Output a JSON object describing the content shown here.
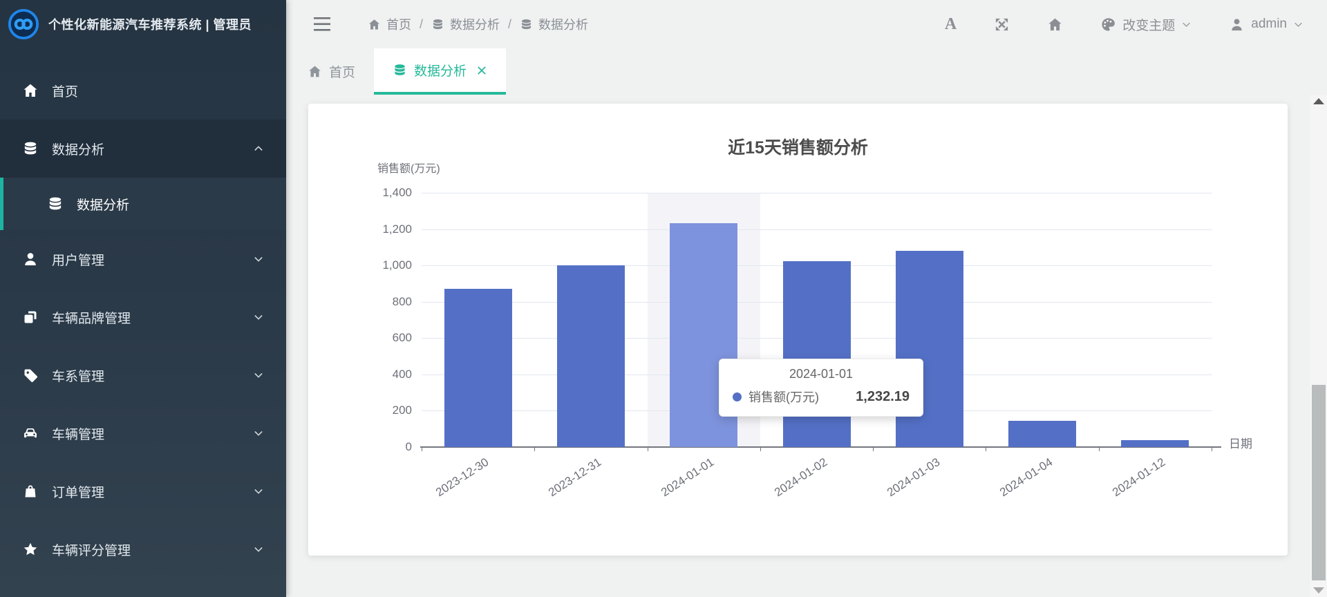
{
  "app": {
    "title": "个性化新能源汽车推荐系统 | 管理员"
  },
  "colors": {
    "accent_tab": "#26b99a",
    "accent_sidebar": "#1db5a2",
    "bar": "#5470c6",
    "bar_highlight": "#7e93dd",
    "grid": "#e2e6f0",
    "sidebar_bg": "#2b3a49",
    "content_bg": "#f0f1f1"
  },
  "sidebar": {
    "items": [
      {
        "name": "home",
        "label": "首页",
        "icon": "home",
        "chevron": null,
        "style": ""
      },
      {
        "name": "data-analysis",
        "label": "数据分析",
        "icon": "database",
        "chevron": "up",
        "style": "expanded"
      },
      {
        "name": "data-analysis-sub",
        "label": "数据分析",
        "icon": "database",
        "chevron": null,
        "style": "sub active"
      },
      {
        "name": "user-management",
        "label": "用户管理",
        "icon": "user",
        "chevron": "down",
        "style": ""
      },
      {
        "name": "vehicle-brand-management",
        "label": "车辆品牌管理",
        "icon": "layers",
        "chevron": "down",
        "style": ""
      },
      {
        "name": "vehicle-series-management",
        "label": "车系管理",
        "icon": "tag",
        "chevron": "down",
        "style": ""
      },
      {
        "name": "vehicle-management",
        "label": "车辆管理",
        "icon": "car",
        "chevron": "down",
        "style": ""
      },
      {
        "name": "order-management",
        "label": "订单管理",
        "icon": "bag",
        "chevron": "down",
        "style": ""
      },
      {
        "name": "vehicle-rating-management",
        "label": "车辆评分管理",
        "icon": "star",
        "chevron": "down",
        "style": ""
      }
    ]
  },
  "header": {
    "breadcrumb": [
      {
        "name": "home",
        "label": "首页",
        "icon": "home"
      },
      {
        "name": "data-analysis",
        "label": "数据分析",
        "icon": "database"
      },
      {
        "name": "data-analysis",
        "label": "数据分析",
        "icon": "database"
      }
    ],
    "font_icon_label": "A",
    "theme_label": "改变主题",
    "user_label": "admin"
  },
  "tabs": [
    {
      "name": "home",
      "label": "首页",
      "icon": "home",
      "active": false,
      "closable": false
    },
    {
      "name": "data-analysis",
      "label": "数据分析",
      "icon": "database",
      "active": true,
      "closable": true
    }
  ],
  "chart_data": {
    "type": "bar",
    "title": "近15天销售额分析",
    "ylabel": "销售额(万元)",
    "xlabel": "日期",
    "categories": [
      "2023-12-30",
      "2023-12-31",
      "2024-01-01",
      "2024-01-02",
      "2024-01-03",
      "2024-01-04",
      "2024-01-12"
    ],
    "values": [
      870,
      1000,
      1232.19,
      1025,
      1080,
      145,
      40
    ],
    "ylim": [
      0,
      1400
    ],
    "ytick_step": 200,
    "ytick_labels": [
      "0",
      "200",
      "400",
      "600",
      "800",
      "1,000",
      "1,200",
      "1,400"
    ],
    "grid": true,
    "highlight_index": 2,
    "series_name": "销售额(万元)",
    "tooltip": {
      "title": "2024-01-01",
      "series": "销售额(万元)",
      "value": "1,232.19"
    }
  }
}
